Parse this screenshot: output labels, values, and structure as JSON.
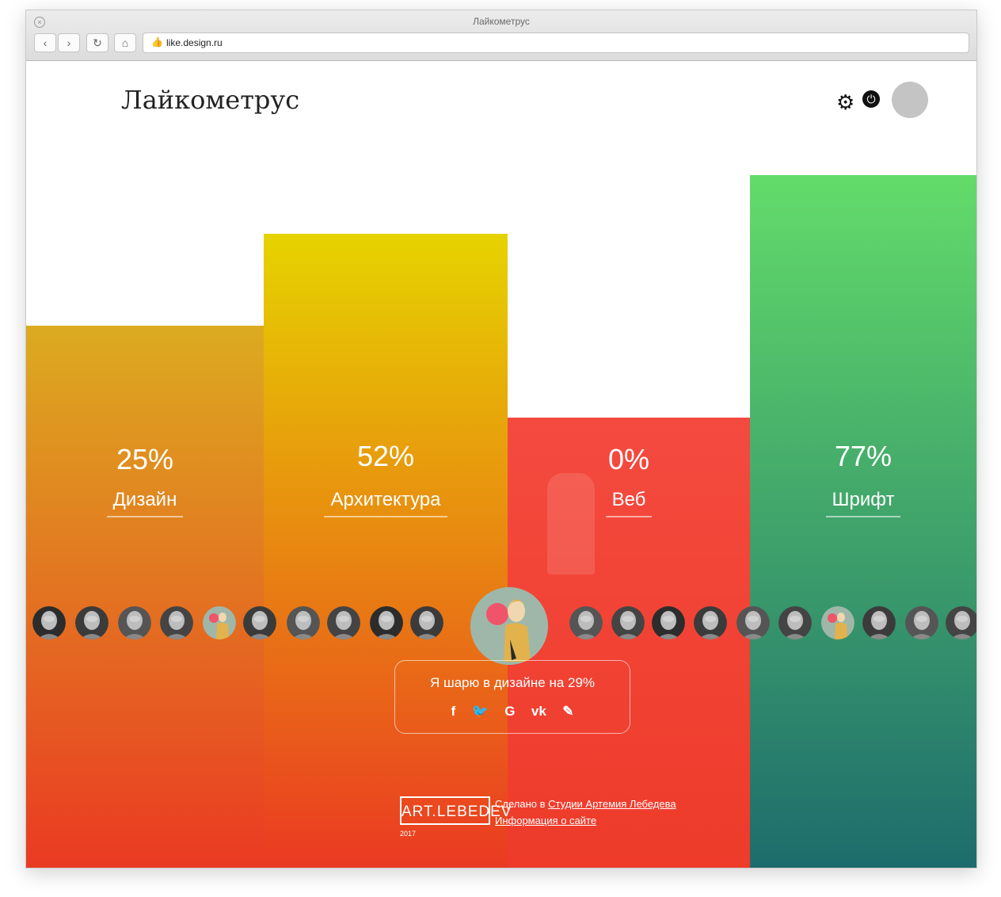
{
  "window": {
    "title": "Лайкометрус",
    "url": "like.design.ru",
    "close_symbol": "×",
    "nav": {
      "back": "‹",
      "forward": "›",
      "reload": "↻",
      "home": "⌂",
      "site_icon": "👍"
    }
  },
  "header": {
    "logo": "Лайкометрус",
    "gear_symbol": "⚙",
    "power_symbol": "⏻"
  },
  "categories": [
    {
      "name": "Дизайн",
      "percent": "25%",
      "color_top": "#dcab20",
      "color_bottom": "#ea3a22"
    },
    {
      "name": "Архитектура",
      "percent": "52%",
      "color_top": "#e6d300",
      "color_bottom": "#ea3a22"
    },
    {
      "name": "Веб",
      "percent": "0%",
      "color_top": "#f44a3f",
      "color_bottom": "#ee3b2a"
    },
    {
      "name": "Шрифт",
      "percent": "77%",
      "color_top": "#63dc6a",
      "color_bottom": "#1d6c6c"
    }
  ],
  "share": {
    "text": "Я шарю в дизайне на 29%",
    "icons": [
      {
        "icon": "facebook-icon",
        "glyph": "f"
      },
      {
        "icon": "twitter-icon",
        "glyph": "🐦"
      },
      {
        "icon": "google-icon",
        "glyph": "G"
      },
      {
        "icon": "vk-icon",
        "glyph": "vk"
      },
      {
        "icon": "livejournal-icon",
        "glyph": "✎"
      }
    ]
  },
  "footer": {
    "logo_text": "ART.LEBEDEV",
    "year": "2017",
    "made_prefix": "Сделано в",
    "studio_link": "Студии Артемия Лебедева",
    "info_link": "Информация о сайте"
  }
}
